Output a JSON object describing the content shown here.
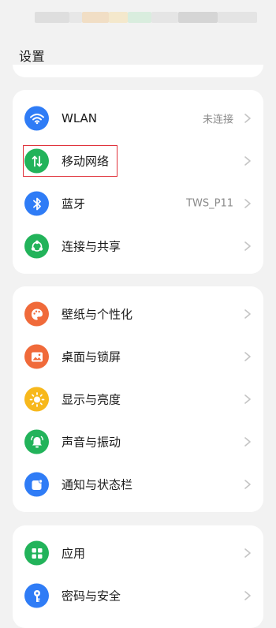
{
  "header": {
    "title": "设置"
  },
  "colors": {
    "background": "#f2f2f2",
    "card": "#ffffff",
    "highlight_box": "#e0313a",
    "wlan_icon_bg": "#2f7cf6",
    "mobile_icon_bg": "#22b35a",
    "bluetooth_icon_bg": "#2f7cf6",
    "share_icon_bg": "#22b35a",
    "wallpaper_icon_bg": "#f06a3a",
    "desktop_icon_bg": "#f06a3a",
    "display_icon_bg": "#f7b81c",
    "sound_icon_bg": "#22b35a",
    "notify_icon_bg": "#2f7cf6",
    "apps_icon_bg": "#22b35a",
    "security_icon_bg": "#2f7cf6"
  },
  "groups": [
    {
      "items": [
        {
          "label": "WLAN",
          "value": "未连接",
          "icon": "wifi-icon"
        },
        {
          "label": "移动网络",
          "value": "",
          "icon": "mobile-data-icon",
          "highlighted": true
        },
        {
          "label": "蓝牙",
          "value": "TWS_P11",
          "icon": "bluetooth-icon"
        },
        {
          "label": "连接与共享",
          "value": "",
          "icon": "share-icon"
        }
      ]
    },
    {
      "items": [
        {
          "label": "壁纸与个性化",
          "value": "",
          "icon": "palette-icon"
        },
        {
          "label": "桌面与锁屏",
          "value": "",
          "icon": "image-icon"
        },
        {
          "label": "显示与亮度",
          "value": "",
          "icon": "sun-icon"
        },
        {
          "label": "声音与振动",
          "value": "",
          "icon": "bell-icon"
        },
        {
          "label": "通知与状态栏",
          "value": "",
          "icon": "notification-icon"
        }
      ]
    },
    {
      "items": [
        {
          "label": "应用",
          "value": "",
          "icon": "apps-grid-icon"
        },
        {
          "label": "密码与安全",
          "value": "",
          "icon": "key-icon"
        }
      ]
    }
  ]
}
